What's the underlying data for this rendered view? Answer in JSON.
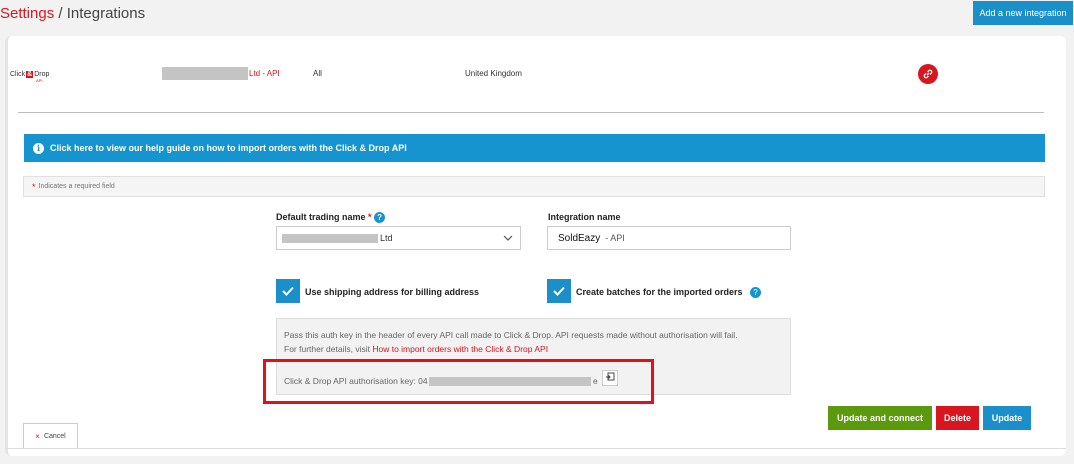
{
  "breadcrumb": {
    "settings": "Settings",
    "separator": "/",
    "current": "Integrations"
  },
  "header": {
    "add_button": "Add a new integration"
  },
  "integration_row": {
    "logo_left": "Click",
    "logo_amp": "&",
    "logo_right": "Drop",
    "logo_sub": "API",
    "name_suffix": "Ltd - API",
    "channel": "All",
    "country": "United Kingdom"
  },
  "help_bar": {
    "text": "Click here to view our help guide on how to import orders with the Click & Drop API"
  },
  "required_note": {
    "star": "*",
    "text": "Indicates a required field"
  },
  "form": {
    "trading_name_label": "Default trading name",
    "trading_name_star": "*",
    "trading_name_value_suffix": "Ltd",
    "integration_name_label": "Integration name",
    "integration_name_value": "SoldEazy",
    "integration_name_suffix": "- API",
    "shipping_checkbox_label": "Use shipping address for billing address",
    "batches_checkbox_label": "Create batches for the imported orders"
  },
  "auth_box": {
    "line1": "Pass this auth key in the header of every API call made to Click & Drop. API requests made without authorisation will fail.",
    "line2_prefix": "For further details, visit ",
    "line2_link": "How to import orders with the Click & Drop API",
    "key_label": "Click & Drop API authorisation key: 04",
    "key_end": "e"
  },
  "buttons": {
    "update_connect": "Update and connect",
    "delete": "Delete",
    "update": "Update",
    "cancel": "Cancel"
  },
  "colors": {
    "brand_red": "#d7161f",
    "blue": "#1694cf",
    "green": "#5a9a0c",
    "highlight_red": "#e0101c"
  }
}
